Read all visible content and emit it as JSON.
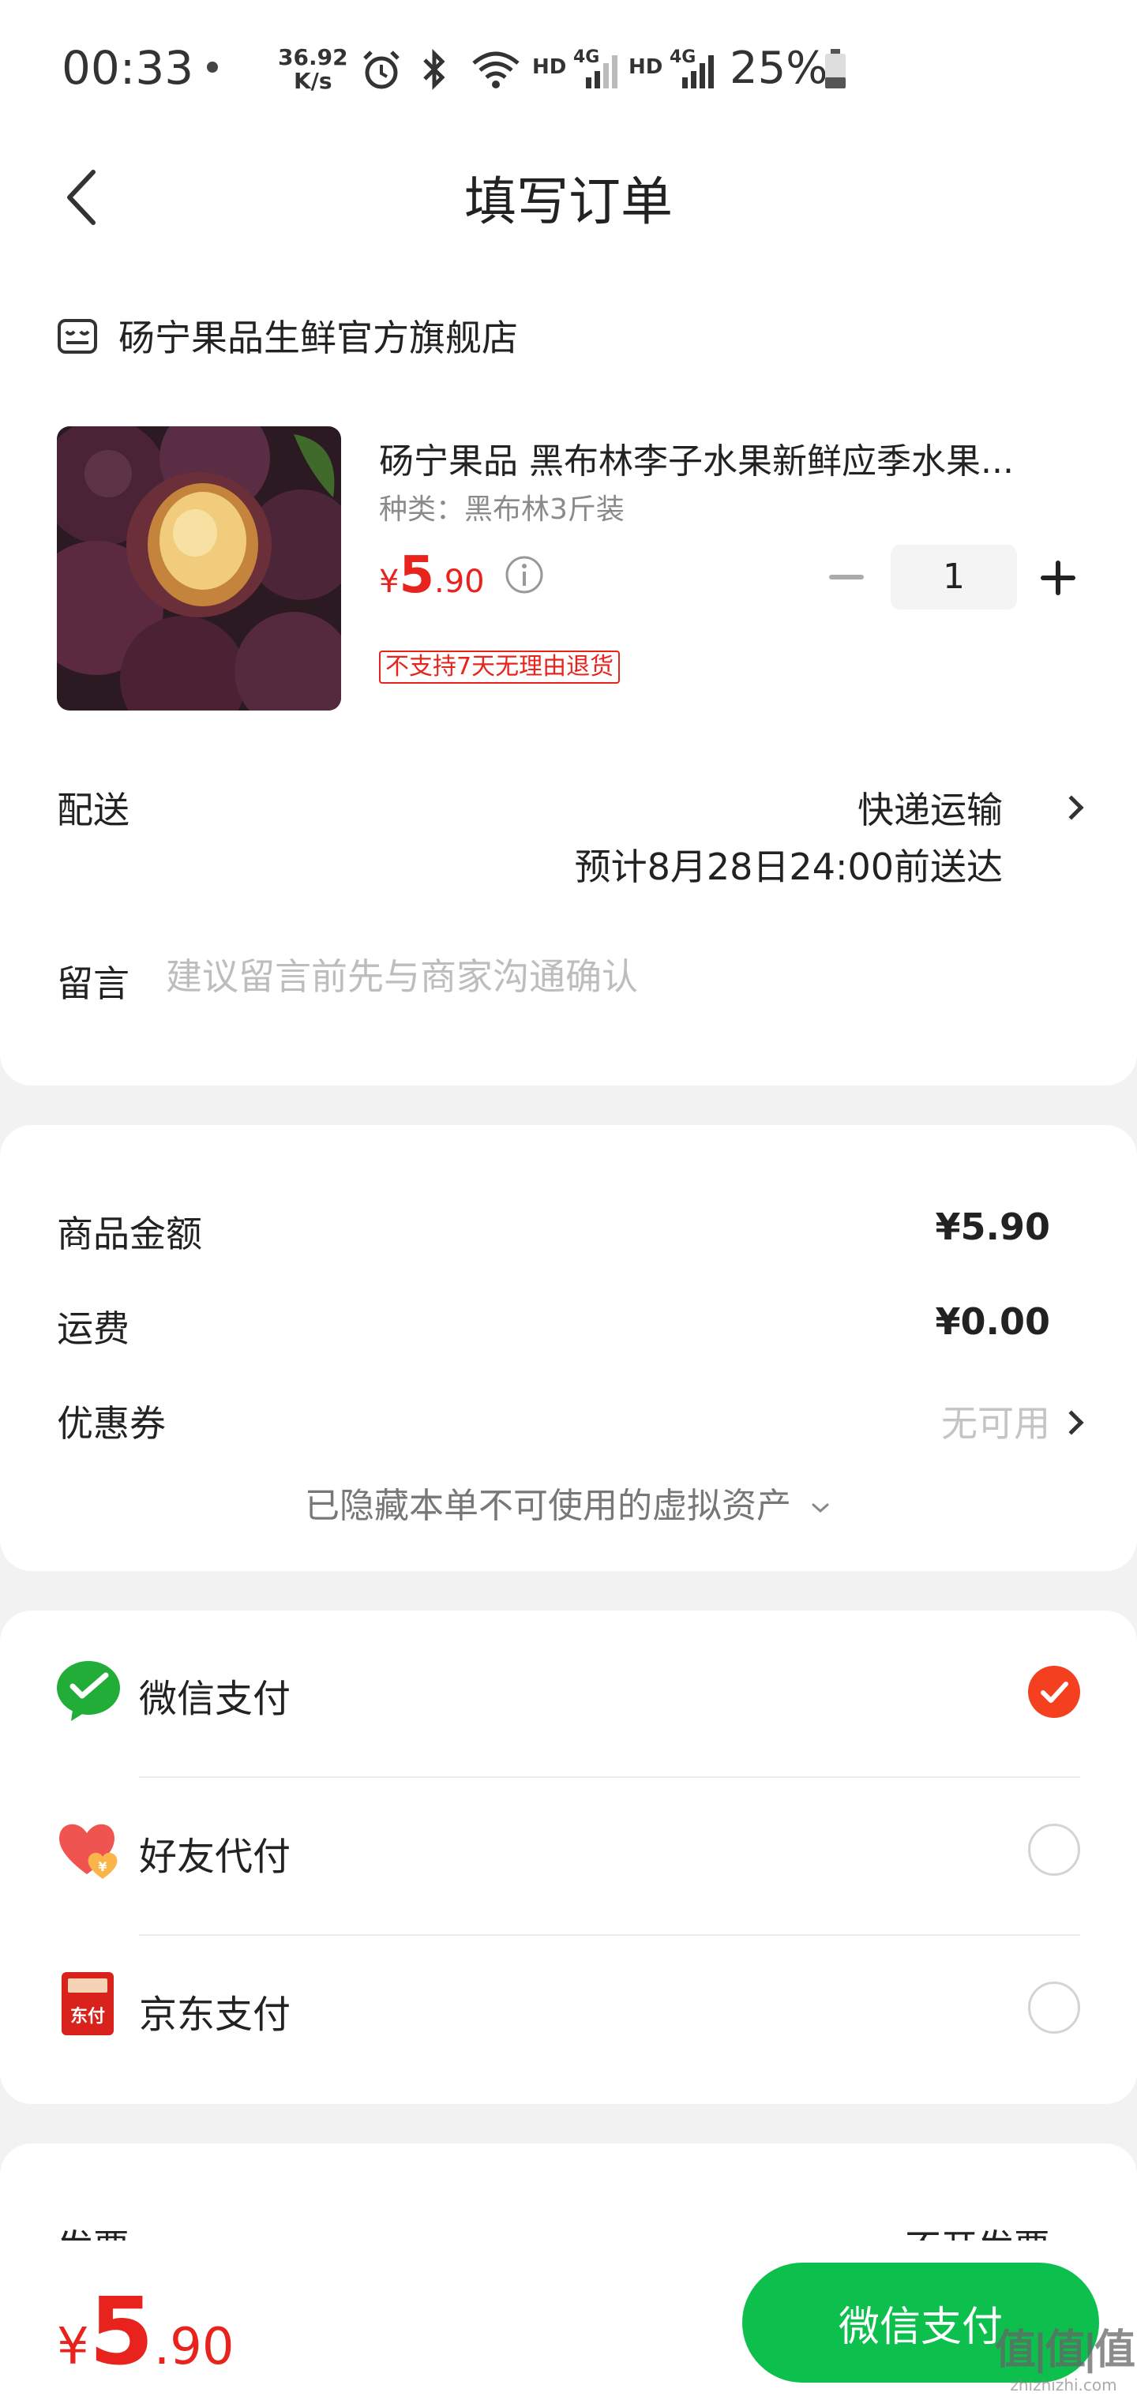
{
  "status_bar": {
    "time": "00:33",
    "net_speed_value": "36.92",
    "net_speed_unit": "K/s",
    "hd1": "HD",
    "net1": "4G",
    "hd2": "HD",
    "net2": "4G",
    "battery": "25%",
    "icons": [
      "alarm-icon",
      "bluetooth-icon",
      "wifi-icon",
      "signal-icon",
      "battery-icon"
    ]
  },
  "nav": {
    "title": "填写订单"
  },
  "store": {
    "name": "砀宁果品生鲜官方旗舰店",
    "product": {
      "title": "砀宁果品 黑布林李子水果新鲜应季水果...",
      "spec": "种类：黑布林3斤装",
      "price_symbol": "¥",
      "price_int": "5",
      "price_dec": ".90",
      "quantity": "1",
      "return_policy": "不支持7天无理由退货"
    },
    "delivery": {
      "label": "配送",
      "method": "快递运输",
      "eta": "预计8月28日24:00前送达"
    },
    "note": {
      "label": "留言",
      "placeholder": "建议留言前先与商家沟通确认"
    }
  },
  "summary": {
    "goods_amount_label": "商品金额",
    "goods_amount": "¥5.90",
    "shipping_label": "运费",
    "shipping": "¥0.00",
    "coupon_label": "优惠券",
    "coupon_value": "无可用",
    "hidden_assets": "已隐藏本单不可使用的虚拟资产"
  },
  "payment": {
    "methods": [
      {
        "label": "微信支付",
        "icon": "wechat-pay-icon",
        "selected": true
      },
      {
        "label": "好友代付",
        "icon": "friend-pay-icon",
        "selected": false
      },
      {
        "label": "京东支付",
        "icon": "jd-pay-icon",
        "selected": false
      }
    ],
    "jd_icon_text": "东付"
  },
  "invoice": {
    "label": "发票",
    "value": "不开发票"
  },
  "footer": {
    "price_symbol": "¥",
    "price_int": "5",
    "price_dec": ".90",
    "pay_button": "微信支付",
    "watermark_main": "值|值|值",
    "watermark_sub": "zhizhizhi.com"
  },
  "colors": {
    "accent_red": "#e8231e",
    "wechat_green": "#0dc04e",
    "selected_orange": "#f4401e"
  }
}
